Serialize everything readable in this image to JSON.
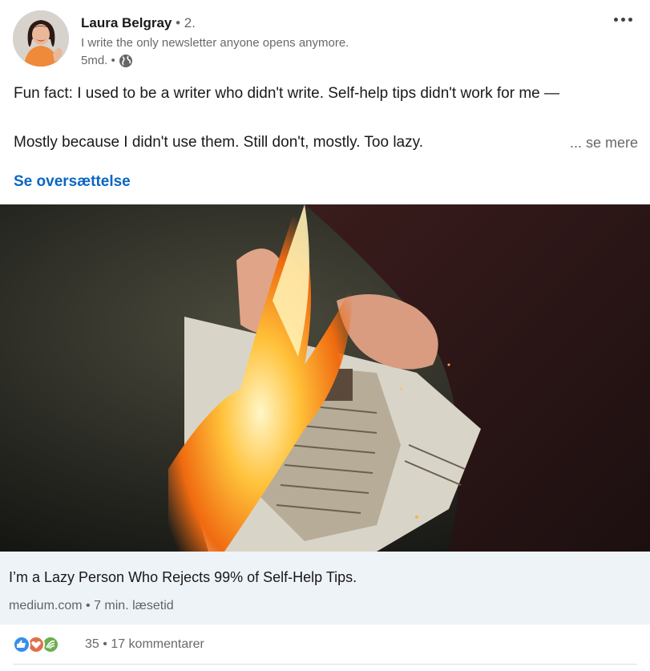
{
  "post": {
    "author": {
      "name": "Laura Belgray",
      "degree": "• 2.",
      "headline": "I write the only newsletter anyone opens anymore.",
      "time": "5md. •"
    },
    "text": {
      "line1": "Fun fact: I used to be a writer who didn't write. Self-help tips didn't work for me —",
      "line2": "Mostly because I didn't use them. Still don't, mostly. Too lazy.",
      "see_more": "... se mere",
      "translate": "Se oversættelse"
    },
    "article": {
      "title": "I’m a Lazy Person Who Rejects 99% of Self-Help Tips.",
      "source": "medium.com • 7 min. læsetid"
    },
    "social": {
      "reaction_icons": [
        "like-icon",
        "love-icon",
        "support-icon"
      ],
      "reaction_count": "35",
      "separator": "•",
      "comments": "17 kommentarer"
    },
    "colors": {
      "link": "#0a66c2",
      "like": "#378fe9",
      "love": "#df704d",
      "support": "#6dae4f",
      "article_bg": "#eef3f8"
    }
  }
}
